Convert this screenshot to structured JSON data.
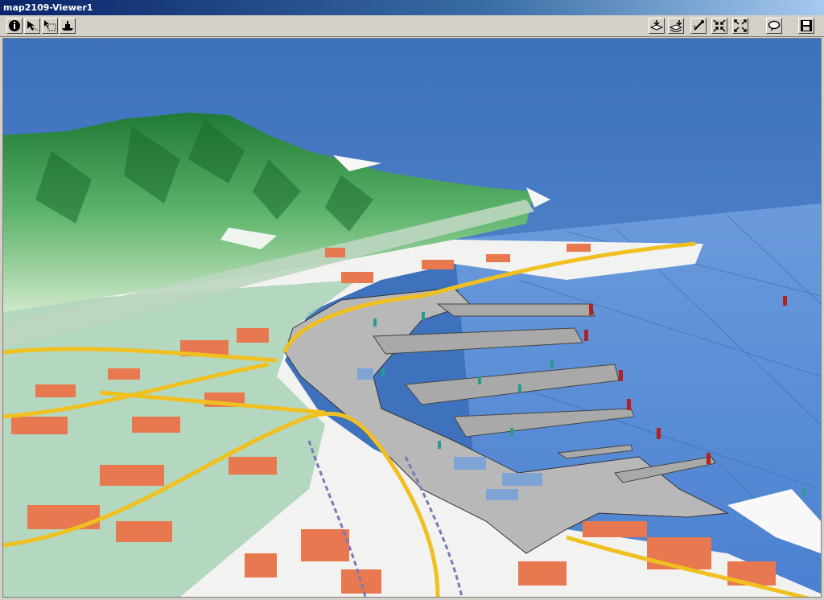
{
  "window": {
    "title": "map2109-Viewer1"
  },
  "toolbar": {
    "left_tools": [
      {
        "icon": "info-icon"
      },
      {
        "icon": "select-tool-icon"
      },
      {
        "icon": "area-select-icon"
      },
      {
        "icon": "ship-icon"
      }
    ],
    "right_tools": [
      {
        "icon": "import-layer-icon"
      },
      {
        "icon": "export-layer-icon"
      },
      {
        "icon": "reset-view-icon"
      },
      {
        "icon": "zoom-in-arrows-icon"
      },
      {
        "icon": "zoom-out-arrows-icon"
      },
      {
        "icon": "speech-bubble-icon"
      },
      {
        "icon": "save-icon"
      }
    ]
  },
  "scene": {
    "description_type": "3D map view",
    "colors": {
      "sky": "#3e72bd",
      "sea": "#5a8fd6",
      "land": "#f4f4f4",
      "terrain": "#5cb46a",
      "roads": "#f0c020",
      "buildings": "#e87850",
      "port": "#b8b8b8"
    }
  }
}
